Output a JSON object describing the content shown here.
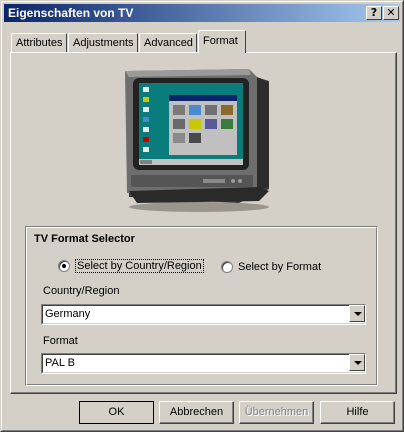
{
  "window": {
    "title": "Eigenschaften von TV",
    "help_glyph": "?",
    "close_glyph": "✕"
  },
  "tabs": [
    {
      "label": "Attributes",
      "active": false
    },
    {
      "label": "Adjustments",
      "active": false
    },
    {
      "label": "Advanced",
      "active": false
    },
    {
      "label": "Format",
      "active": true
    }
  ],
  "image": {
    "icon": "tv-monitor-icon"
  },
  "group": {
    "title": "TV Format Selector",
    "radio_country": {
      "label": "Select by Country/Region",
      "checked": true
    },
    "radio_format": {
      "label": "Select by Format",
      "checked": false
    },
    "country_label": "Country/Region",
    "country_value": "Germany",
    "format_label": "Format",
    "format_value": "PAL B"
  },
  "buttons": {
    "ok": "OK",
    "cancel": "Abbrechen",
    "apply": "Übernehmen",
    "help": "Hilfe"
  },
  "colors": {
    "titlebar_start": "#0a246a",
    "titlebar_end": "#a6caf0",
    "face": "#d4d0c8"
  }
}
